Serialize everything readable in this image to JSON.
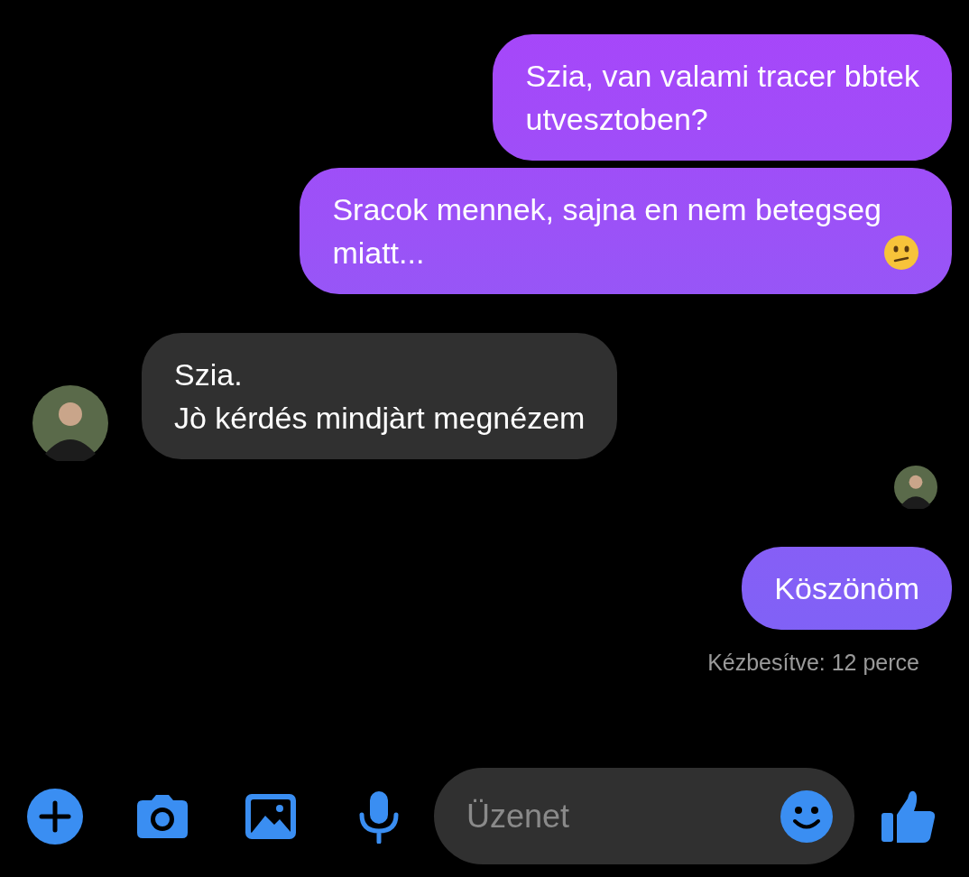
{
  "messages": [
    {
      "kind": "sent",
      "text": "Szia, van valami tracer bbtek\nutvesztoben?"
    },
    {
      "kind": "sent",
      "text": "Sracok mennek, sajna en nem betegseg\nmiatt...",
      "emoji": true
    },
    {
      "kind": "received",
      "text": "Szia.\nJò kérdés mindjàrt megnézem"
    },
    {
      "kind": "seen"
    },
    {
      "kind": "sent",
      "text": "Köszönöm"
    },
    {
      "kind": "status",
      "text": "Kézbesítve: 12 perce"
    }
  ],
  "composer": {
    "placeholder": "Üzenet"
  }
}
